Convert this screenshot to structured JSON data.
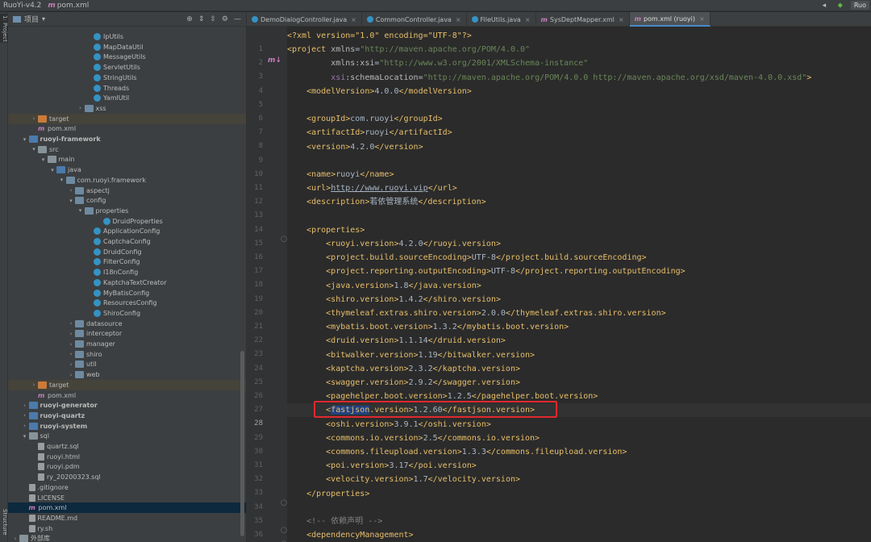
{
  "topbar": {
    "project": "RuoYi-v4.2",
    "file": "pom.xml",
    "run_config": "Ruo"
  },
  "side_stripe": {
    "top_tab": "1: Project",
    "bottom_tab": "Structure"
  },
  "project_panel": {
    "view_mode": "项目",
    "tree": [
      {
        "label": "IpUtils",
        "depth": 8,
        "icon": "class"
      },
      {
        "label": "MapDataUtil",
        "depth": 8,
        "icon": "class"
      },
      {
        "label": "MessageUtils",
        "depth": 8,
        "icon": "class"
      },
      {
        "label": "ServletUtils",
        "depth": 8,
        "icon": "class"
      },
      {
        "label": "StringUtils",
        "depth": 8,
        "icon": "class"
      },
      {
        "label": "Threads",
        "depth": 8,
        "icon": "class"
      },
      {
        "label": "YamlUtil",
        "depth": 8,
        "icon": "class"
      },
      {
        "label": "xss",
        "depth": 7,
        "icon": "package",
        "arrow": "›"
      },
      {
        "label": "target",
        "depth": 2,
        "icon": "folder-excluded",
        "arrow": "›",
        "highlight": true
      },
      {
        "label": "pom.xml",
        "depth": 2,
        "icon": "xml"
      },
      {
        "label": "ruoyi-framework",
        "depth": 1,
        "icon": "module",
        "arrow": "⌄",
        "bold": true
      },
      {
        "label": "src",
        "depth": 2,
        "icon": "folder",
        "arrow": "⌄"
      },
      {
        "label": "main",
        "depth": 3,
        "icon": "folder",
        "arrow": "⌄"
      },
      {
        "label": "java",
        "depth": 4,
        "icon": "folder-source",
        "arrow": "⌄"
      },
      {
        "label": "com.ruoyi.framework",
        "depth": 5,
        "icon": "package",
        "arrow": "⌄"
      },
      {
        "label": "aspectj",
        "depth": 6,
        "icon": "package",
        "arrow": "›"
      },
      {
        "label": "config",
        "depth": 6,
        "icon": "package",
        "arrow": "⌄"
      },
      {
        "label": "properties",
        "depth": 7,
        "icon": "package",
        "arrow": "⌄"
      },
      {
        "label": "DruidProperties",
        "depth": 9,
        "icon": "class"
      },
      {
        "label": "ApplicationConfig",
        "depth": 8,
        "icon": "class"
      },
      {
        "label": "CaptchaConfig",
        "depth": 8,
        "icon": "class"
      },
      {
        "label": "DruidConfig",
        "depth": 8,
        "icon": "class"
      },
      {
        "label": "FilterConfig",
        "depth": 8,
        "icon": "class"
      },
      {
        "label": "I18nConfig",
        "depth": 8,
        "icon": "class"
      },
      {
        "label": "KaptchaTextCreator",
        "depth": 8,
        "icon": "class"
      },
      {
        "label": "MyBatisConfig",
        "depth": 8,
        "icon": "class"
      },
      {
        "label": "ResourcesConfig",
        "depth": 8,
        "icon": "class"
      },
      {
        "label": "ShiroConfig",
        "depth": 8,
        "icon": "class"
      },
      {
        "label": "datasource",
        "depth": 6,
        "icon": "package",
        "arrow": "›"
      },
      {
        "label": "interceptor",
        "depth": 6,
        "icon": "package",
        "arrow": "›"
      },
      {
        "label": "manager",
        "depth": 6,
        "icon": "package",
        "arrow": "›"
      },
      {
        "label": "shiro",
        "depth": 6,
        "icon": "package",
        "arrow": "›"
      },
      {
        "label": "util",
        "depth": 6,
        "icon": "package",
        "arrow": "›"
      },
      {
        "label": "web",
        "depth": 6,
        "icon": "package",
        "arrow": "›"
      },
      {
        "label": "target",
        "depth": 2,
        "icon": "folder-excluded",
        "arrow": "›",
        "highlight": true
      },
      {
        "label": "pom.xml",
        "depth": 2,
        "icon": "xml"
      },
      {
        "label": "ruoyi-generator",
        "depth": 1,
        "icon": "module",
        "arrow": "›",
        "bold": true
      },
      {
        "label": "ruoyi-quartz",
        "depth": 1,
        "icon": "module",
        "arrow": "›",
        "bold": true
      },
      {
        "label": "ruoyi-system",
        "depth": 1,
        "icon": "module",
        "arrow": "›",
        "bold": true
      },
      {
        "label": "sql",
        "depth": 1,
        "icon": "folder",
        "arrow": "⌄"
      },
      {
        "label": "quartz.sql",
        "depth": 2,
        "icon": "file"
      },
      {
        "label": "ruoyi.html",
        "depth": 2,
        "icon": "file"
      },
      {
        "label": "ruoyi.pdm",
        "depth": 2,
        "icon": "file"
      },
      {
        "label": "ry_20200323.sql",
        "depth": 2,
        "icon": "file"
      },
      {
        "label": ".gitignore",
        "depth": 1,
        "icon": "file"
      },
      {
        "label": "LICENSE",
        "depth": 1,
        "icon": "file"
      },
      {
        "label": "pom.xml",
        "depth": 1,
        "icon": "xml",
        "selected": true
      },
      {
        "label": "README.md",
        "depth": 1,
        "icon": "file"
      },
      {
        "label": "ry.sh",
        "depth": 1,
        "icon": "file"
      },
      {
        "label": "外部库",
        "depth": 0,
        "icon": "folder",
        "arrow": "›"
      }
    ]
  },
  "editor": {
    "tabs": [
      {
        "label": "DemoDialogController.java",
        "icon": "class"
      },
      {
        "label": "CommonController.java",
        "icon": "class"
      },
      {
        "label": "FileUtils.java",
        "icon": "class"
      },
      {
        "label": "SysDeptMapper.xml",
        "icon": "xml"
      },
      {
        "label": "pom.xml (ruoyi)",
        "icon": "xml",
        "active": true
      }
    ],
    "current_line": 28,
    "highlighted_line": 28,
    "lines": [
      {
        "n": "1",
        "t": [
          [
            "<?xml version=\"1.0\" encoding=\"UTF-8\"?>",
            "tag"
          ]
        ]
      },
      {
        "n": "2",
        "t": [
          [
            "<project ",
            "tag"
          ],
          [
            "xmlns",
            "attr"
          ],
          [
            "=",
            "txt"
          ],
          [
            "\"http://maven.apache.org/POM/4.0.0\"",
            "str"
          ]
        ]
      },
      {
        "n": "3",
        "t": [
          [
            "         ",
            "txt"
          ],
          [
            "xmlns:xsi",
            "attr"
          ],
          [
            "=",
            "txt"
          ],
          [
            "\"http://www.w3.org/2001/XMLSchema-instance\"",
            "str"
          ]
        ]
      },
      {
        "n": "4",
        "t": [
          [
            "         ",
            "txt"
          ],
          [
            "xsi",
            "nsattr"
          ],
          [
            ":schemaLocation",
            "attr"
          ],
          [
            "=",
            "txt"
          ],
          [
            "\"http://maven.apache.org/POM/4.0.0 http://maven.apache.org/xsd/maven-4.0.0.xsd\"",
            "str"
          ],
          [
            ">",
            "tag"
          ]
        ]
      },
      {
        "n": "5",
        "t": [
          [
            "    <modelVersion>",
            "tag"
          ],
          [
            "4.0.0",
            "txt"
          ],
          [
            "</modelVersion>",
            "tag"
          ]
        ]
      },
      {
        "n": "6",
        "t": []
      },
      {
        "n": "7",
        "t": [
          [
            "    <groupId>",
            "tag"
          ],
          [
            "com.ruoyi",
            "txt"
          ],
          [
            "</groupId>",
            "tag"
          ]
        ]
      },
      {
        "n": "8",
        "t": [
          [
            "    <artifactId>",
            "tag"
          ],
          [
            "ruoyi",
            "txt"
          ],
          [
            "</artifactId>",
            "tag"
          ]
        ]
      },
      {
        "n": "9",
        "t": [
          [
            "    <version>",
            "tag"
          ],
          [
            "4.2.0",
            "txt"
          ],
          [
            "</version>",
            "tag"
          ]
        ]
      },
      {
        "n": "10",
        "t": []
      },
      {
        "n": "11",
        "t": [
          [
            "    <name>",
            "tag"
          ],
          [
            "ruoyi",
            "txt"
          ],
          [
            "</name>",
            "tag"
          ]
        ]
      },
      {
        "n": "12",
        "t": [
          [
            "    <url>",
            "tag"
          ],
          [
            "http://www.ruoyi.vip",
            "url"
          ],
          [
            "</url>",
            "tag"
          ]
        ]
      },
      {
        "n": "13",
        "t": [
          [
            "    <description>",
            "tag"
          ],
          [
            "若依管理系统",
            "txt"
          ],
          [
            "</description>",
            "tag"
          ]
        ]
      },
      {
        "n": "14",
        "t": []
      },
      {
        "n": "15",
        "t": [
          [
            "    <properties>",
            "tag"
          ]
        ]
      },
      {
        "n": "16",
        "t": [
          [
            "        <ruoyi.version>",
            "tag"
          ],
          [
            "4.2.0",
            "txt"
          ],
          [
            "</ruoyi.version>",
            "tag"
          ]
        ]
      },
      {
        "n": "17",
        "t": [
          [
            "        <project.build.sourceEncoding>",
            "tag"
          ],
          [
            "UTF-8",
            "txt"
          ],
          [
            "</project.build.sourceEncoding>",
            "tag"
          ]
        ]
      },
      {
        "n": "18",
        "t": [
          [
            "        <project.reporting.outputEncoding>",
            "tag"
          ],
          [
            "UTF-8",
            "txt"
          ],
          [
            "</project.reporting.outputEncoding>",
            "tag"
          ]
        ]
      },
      {
        "n": "19",
        "t": [
          [
            "        <java.version>",
            "tag"
          ],
          [
            "1.8",
            "txt"
          ],
          [
            "</java.version>",
            "tag"
          ]
        ]
      },
      {
        "n": "20",
        "t": [
          [
            "        <shiro.version>",
            "tag"
          ],
          [
            "1.4.2",
            "txt"
          ],
          [
            "</shiro.version>",
            "tag"
          ]
        ]
      },
      {
        "n": "21",
        "t": [
          [
            "        <thymeleaf.extras.shiro.version>",
            "tag"
          ],
          [
            "2.0.0",
            "txt"
          ],
          [
            "</thymeleaf.extras.shiro.version>",
            "tag"
          ]
        ]
      },
      {
        "n": "22",
        "t": [
          [
            "        <mybatis.boot.version>",
            "tag"
          ],
          [
            "1.3.2",
            "txt"
          ],
          [
            "</mybatis.boot.version>",
            "tag"
          ]
        ]
      },
      {
        "n": "23",
        "t": [
          [
            "        <druid.version>",
            "tag"
          ],
          [
            "1.1.14",
            "txt"
          ],
          [
            "</druid.version>",
            "tag"
          ]
        ]
      },
      {
        "n": "24",
        "t": [
          [
            "        <bitwalker.version>",
            "tag"
          ],
          [
            "1.19",
            "txt"
          ],
          [
            "</bitwalker.version>",
            "tag"
          ]
        ]
      },
      {
        "n": "25",
        "t": [
          [
            "        <kaptcha.version>",
            "tag"
          ],
          [
            "2.3.2",
            "txt"
          ],
          [
            "</kaptcha.version>",
            "tag"
          ]
        ]
      },
      {
        "n": "26",
        "t": [
          [
            "        <swagger.version>",
            "tag"
          ],
          [
            "2.9.2",
            "txt"
          ],
          [
            "</swagger.version>",
            "tag"
          ]
        ]
      },
      {
        "n": "27",
        "t": [
          [
            "        <pagehelper.boot.version>",
            "tag"
          ],
          [
            "1.2.5",
            "txt"
          ],
          [
            "</pagehelper.boot.version>",
            "tag"
          ]
        ]
      },
      {
        "n": "28",
        "t": [
          [
            "        <",
            "tag"
          ],
          [
            "fastjson",
            "sel"
          ],
          [
            ".version>",
            "tag"
          ],
          [
            "1.2.60",
            "txt"
          ],
          [
            "</fastjson.version>",
            "tag"
          ]
        ]
      },
      {
        "n": "29",
        "t": [
          [
            "        <oshi.version>",
            "tag"
          ],
          [
            "3.9.1",
            "txt"
          ],
          [
            "</oshi.version>",
            "tag"
          ]
        ]
      },
      {
        "n": "30",
        "t": [
          [
            "        <commons.io.version>",
            "tag"
          ],
          [
            "2.5",
            "txt"
          ],
          [
            "</commons.io.version>",
            "tag"
          ]
        ]
      },
      {
        "n": "31",
        "t": [
          [
            "        <commons.fileupload.version>",
            "tag"
          ],
          [
            "1.3.3",
            "txt"
          ],
          [
            "</commons.fileupload.version>",
            "tag"
          ]
        ]
      },
      {
        "n": "32",
        "t": [
          [
            "        <poi.version>",
            "tag"
          ],
          [
            "3.17",
            "txt"
          ],
          [
            "</poi.version>",
            "tag"
          ]
        ]
      },
      {
        "n": "33",
        "t": [
          [
            "        <velocity.version>",
            "tag"
          ],
          [
            "1.7",
            "txt"
          ],
          [
            "</velocity.version>",
            "tag"
          ]
        ]
      },
      {
        "n": "34",
        "t": [
          [
            "    </properties>",
            "tag"
          ]
        ]
      },
      {
        "n": "35",
        "t": []
      },
      {
        "n": "36",
        "t": [
          [
            "    <!-- 依赖声明 -->",
            "com"
          ]
        ]
      },
      {
        "n": "37",
        "t": [
          [
            "    <dependencyManagement>",
            "tag"
          ]
        ]
      }
    ]
  },
  "colors": {
    "tag": "#e8bf6a",
    "text": "#a9b7c6",
    "string": "#6a8759",
    "comment": "#808080",
    "selection": "#214283",
    "annotation_box": "#e0282e"
  }
}
